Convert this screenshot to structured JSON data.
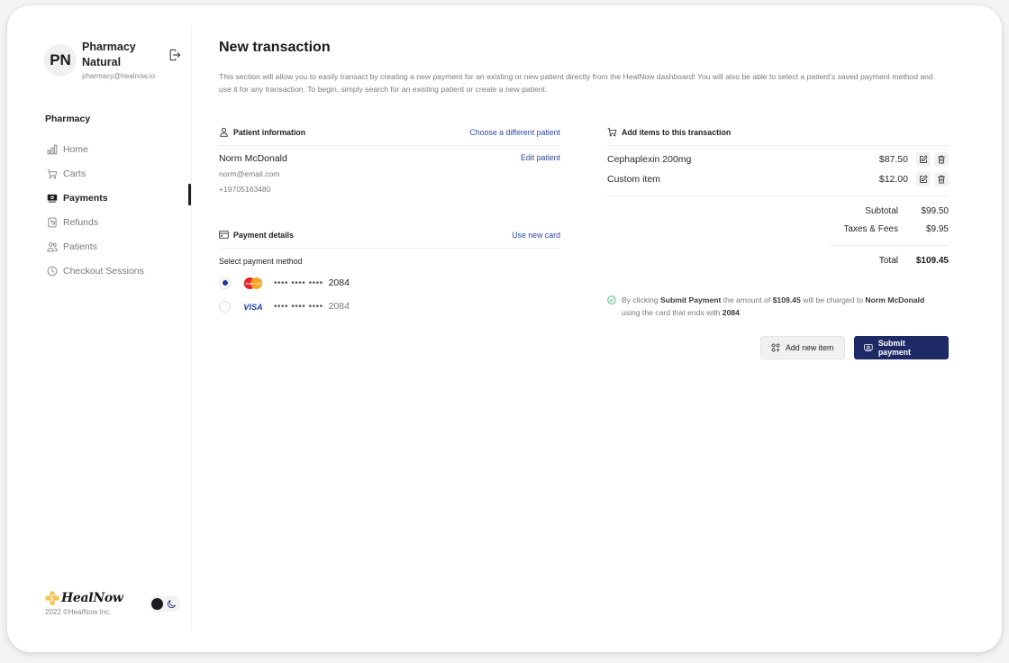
{
  "sidebar": {
    "profile": {
      "initials": "PN",
      "name": "Pharmacy Natural",
      "email": "pharmacy@healnow.io"
    },
    "section_label": "Pharmacy",
    "nav": [
      {
        "label": "Home",
        "icon": "bar-chart-icon",
        "active": false
      },
      {
        "label": "Carts",
        "icon": "cart-icon",
        "active": false
      },
      {
        "label": "Payments",
        "icon": "payments-icon",
        "active": true
      },
      {
        "label": "Refunds",
        "icon": "refund-icon",
        "active": false
      },
      {
        "label": "Patients",
        "icon": "users-icon",
        "active": false
      },
      {
        "label": "Checkout Sessions",
        "icon": "clock-icon",
        "active": false
      }
    ],
    "brand": {
      "name": "HealNow",
      "copyright": "2022 ©HealNow Inc.",
      "logo_color": "#f5c451"
    },
    "theme": "light"
  },
  "main": {
    "title": "New transaction",
    "intro": "This section will allow you to easily transact by creating a new payment for an existing or new patient directly from the HealNow dashboard! You will also be able to select a patient's saved payment method and use it for any transaction. To begin, simply search for an existing patient or create a new patient.",
    "patient_section": {
      "title": "Patient information",
      "action": "Choose a different patient",
      "name": "Norm McDonald",
      "email": "norm@email.com",
      "phone": "+19705163480",
      "edit": "Edit patient"
    },
    "payment_section": {
      "title": "Payment details",
      "action": "Use new card",
      "select_label": "Select payment method",
      "cards": [
        {
          "brand": "Mastercard",
          "masked": "•••• •••• ••••",
          "last4": "2084",
          "selected": true
        },
        {
          "brand": "Visa",
          "masked": "•••• •••• ••••",
          "last4": "2084",
          "selected": false
        }
      ]
    },
    "items_section": {
      "title": "Add items to this transaction",
      "items": [
        {
          "name": "Cephaplexin 200mg",
          "price": "$87.50"
        },
        {
          "name": "Custom item",
          "price": "$12.00"
        }
      ],
      "subtotal_label": "Subtotal",
      "subtotal": "$99.50",
      "taxes_label": "Taxes & Fees",
      "taxes": "$9.95",
      "total_label": "Total",
      "total": "$109.45"
    },
    "notice": {
      "p1": "By clicking ",
      "b1": "Submit Payment",
      "p2": " the amount of ",
      "b2": "$109.45",
      "p3": " will be charged to ",
      "b3": "Norm McDonald",
      "p4": " using the card that ends with ",
      "b4": "2084"
    },
    "buttons": {
      "add_item": "Add new item",
      "submit": "Submit payment"
    },
    "colors": {
      "accent_link": "#2c4a9a",
      "primary_button": "#1d2a66",
      "success": "#3fae6a"
    }
  }
}
